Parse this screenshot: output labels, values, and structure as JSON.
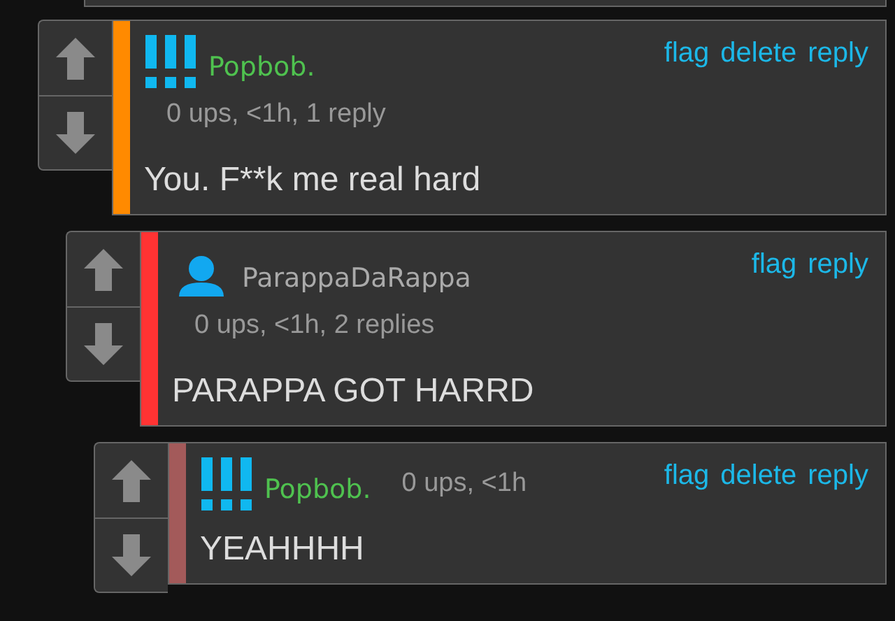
{
  "comments": [
    {
      "kind": "full",
      "avatar": {
        "kind": "badge"
      },
      "username": "Popbob.",
      "meta": "0 ups, <1h, 1 reply",
      "actions": [
        "flag",
        "delete",
        "reply"
      ],
      "body": "You. F**k me real hard",
      "color": "#ff8a00",
      "children": [
        {
          "kind": "full",
          "avatar": {
            "kind": "person"
          },
          "username": "ParappaDaRappa",
          "meta": "0 ups, <1h, 2 replies",
          "actions": [
            "flag",
            "reply"
          ],
          "body": "PARAPPA GOT HARRD",
          "color": "#ff3333",
          "children": [
            {
              "kind": "compact",
              "avatar": {
                "kind": "badge"
              },
              "username": "Popbob.",
              "meta": "0 ups, <1h",
              "actions": [
                "flag",
                "delete",
                "reply"
              ],
              "body": "YEAHHHH",
              "color": "#a35a5a"
            }
          ]
        }
      ]
    }
  ]
}
